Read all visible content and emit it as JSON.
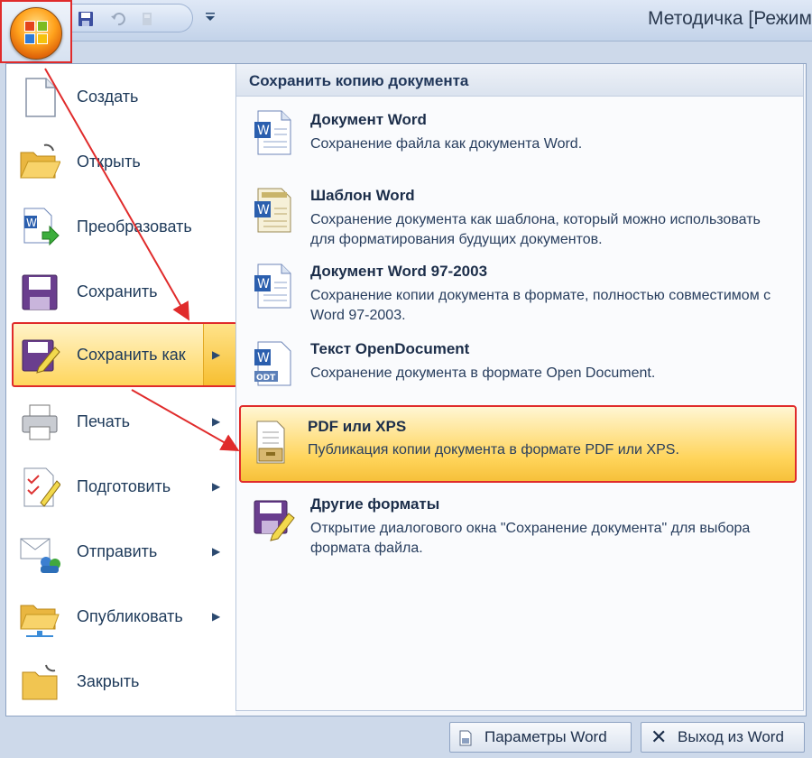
{
  "window": {
    "title": "Методичка [Режим"
  },
  "office_button": {
    "icon": "office-logo-icon"
  },
  "quick_access": {
    "icons": [
      "save-icon",
      "undo-icon",
      "redo-icon",
      "customize-dropdown-icon"
    ]
  },
  "left_menu": {
    "items": [
      {
        "label": "Создать",
        "icon": "new-document-icon",
        "submenu": false
      },
      {
        "label": "Открыть",
        "icon": "open-folder-icon",
        "submenu": false
      },
      {
        "label": "Преобразовать",
        "icon": "convert-icon",
        "submenu": false
      },
      {
        "label": "Сохранить",
        "icon": "save-icon",
        "submenu": false
      },
      {
        "label": "Сохранить как",
        "icon": "save-as-icon",
        "submenu": true,
        "selected": true
      },
      {
        "label": "Печать",
        "icon": "printer-icon",
        "submenu": true
      },
      {
        "label": "Подготовить",
        "icon": "prepare-icon",
        "submenu": true
      },
      {
        "label": "Отправить",
        "icon": "send-icon",
        "submenu": true
      },
      {
        "label": "Опубликовать",
        "icon": "publish-icon",
        "submenu": true
      },
      {
        "label": "Закрыть",
        "icon": "close-folder-icon",
        "submenu": false
      }
    ]
  },
  "submenu": {
    "header": "Сохранить копию документа",
    "items": [
      {
        "title": "Документ Word",
        "desc": "Сохранение файла как документа Word.",
        "icon": "word-document-icon"
      },
      {
        "title": "Шаблон Word",
        "desc": "Сохранение документа как шаблона, который можно использовать для форматирования будущих документов.",
        "icon": "word-template-icon"
      },
      {
        "title": "Документ Word 97-2003",
        "desc": "Сохранение копии документа в формате, полностью совместимом с Word 97-2003.",
        "icon": "word-97-document-icon"
      },
      {
        "title": "Текст OpenDocument",
        "desc": "Сохранение документа в формате Open Document.",
        "icon": "odt-document-icon",
        "badge": "ODT"
      },
      {
        "title": "PDF или XPS",
        "desc": "Публикация копии документа в формате PDF или XPS.",
        "icon": "pdf-xps-icon",
        "highlighted": true
      },
      {
        "title": "Другие форматы",
        "desc": "Открытие диалогового окна \"Сохранение документа\" для выбора формата файла.",
        "icon": "other-formats-icon"
      }
    ]
  },
  "bottom": {
    "options_label": "Параметры Word",
    "exit_label": "Выход из Word"
  },
  "colors": {
    "highlight_border": "#e02b2b",
    "highlight_fill": "#ffd65e",
    "text": "#1e3a5a"
  }
}
